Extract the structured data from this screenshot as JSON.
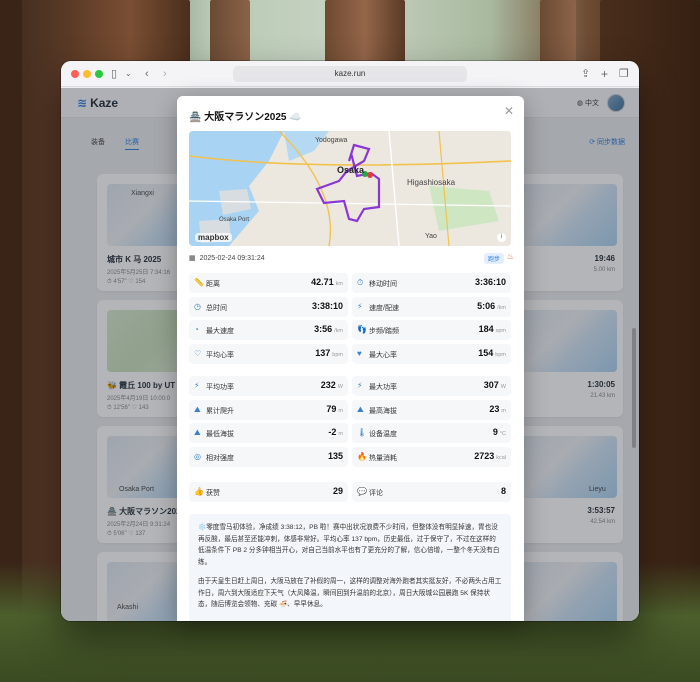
{
  "browser": {
    "url": "kaze.run"
  },
  "app": {
    "brand": "Kaze",
    "lang": "中文",
    "sync_label": "同步数据"
  },
  "nav": {
    "tab_gear": "装备",
    "tab_race": "比赛"
  },
  "cards": [
    {
      "title": "城市 K 马 2025",
      "sub": "2025年5月25日 7:34:16",
      "meta": "⏱ 4'57\"  ♡ 154"
    },
    {
      "title": "🐝 霞丘 100 by UT",
      "sub": "2025年4月19日 10:00:0",
      "meta": "⏱ 12'56\"  ♡ 143"
    },
    {
      "title": "🏯 大阪マラソン2025",
      "sub": "2025年2月24日 9:31:24",
      "meta": "⏱ 5'06\"  ♡ 137"
    },
    {
      "right_value": "19:46",
      "right_unit": "5.00 km"
    },
    {
      "right_value": "1:30:05",
      "right_unit": "21.43 km"
    },
    {
      "right_value": "3:53:57",
      "right_unit": "42.54 km"
    }
  ],
  "map_labels": {
    "card_left_1": "Xiangxi",
    "card_left_3": "Osaka Port",
    "card_left_4": "Akashi",
    "card_right_3": "Lieyu"
  },
  "modal": {
    "title": "🏯 大阪マラソン2025 ☁️",
    "date": "2025-02-24 09:31:24",
    "tag": "跑步",
    "map": {
      "yodogawa": "Yodogawa",
      "osaka": "Osaka",
      "higashiosaka": "Higashiosaka",
      "yao": "Yao",
      "osaka_port": "Osaka Port",
      "mapbox": "mapbox"
    },
    "stats_a": [
      {
        "icon": "📏",
        "label": "距离",
        "value": "42.71",
        "unit": "km"
      },
      {
        "icon": "⏱",
        "label": "移动时间",
        "value": "3:36:10",
        "unit": ""
      },
      {
        "icon": "◷",
        "label": "总时间",
        "value": "3:38:10",
        "unit": ""
      },
      {
        "icon": "⚡",
        "label": "速度/配速",
        "value": "5:06",
        "unit": "/km"
      },
      {
        "icon": "◔",
        "label": "最大速度",
        "value": "3:56",
        "unit": "/km"
      },
      {
        "icon": "👣",
        "label": "步频/踏频",
        "value": "184",
        "unit": "spm"
      },
      {
        "icon": "♡",
        "label": "平均心率",
        "value": "137",
        "unit": "bpm"
      },
      {
        "icon": "♥",
        "label": "最大心率",
        "value": "154",
        "unit": "bpm"
      }
    ],
    "stats_b": [
      {
        "icon": "⚡",
        "label": "平均功率",
        "value": "232",
        "unit": "W"
      },
      {
        "icon": "⚡",
        "label": "最大功率",
        "value": "307",
        "unit": "W"
      },
      {
        "icon": "⛰",
        "label": "累计爬升",
        "value": "79",
        "unit": "m"
      },
      {
        "icon": "⛰",
        "label": "最高海拔",
        "value": "23",
        "unit": "m"
      },
      {
        "icon": "⛰",
        "label": "最低海拔",
        "value": "-2",
        "unit": "m"
      },
      {
        "icon": "🌡",
        "label": "设备温度",
        "value": "9",
        "unit": "°C"
      },
      {
        "icon": "◎",
        "label": "相对强度",
        "value": "135",
        "unit": ""
      },
      {
        "icon": "🔥",
        "label": "热量消耗",
        "value": "2723",
        "unit": "kcal"
      }
    ],
    "stats_c": [
      {
        "icon": "👍",
        "label": "获赞",
        "value": "29",
        "unit": ""
      },
      {
        "icon": "💬",
        "label": "评论",
        "value": "8",
        "unit": ""
      }
    ],
    "note_p1": "❄️零度雪马初体验，净成绩 3:38:12，PB 啦！赛中出状况浪费不少时间，但整体没有明显掉速，胃也没再反酸，最后甚至还能冲刺，体感非常好。平均心率 137 bpm，历史最低，过于保守了，不过在这样的低温条件下 PB 2 分多钟相当开心，对自己当前水平也有了更充分的了解，信心倍增，一整个冬天没有白练。",
    "note_p2": "由于天皇生日赶上周日，大阪马放在了补假的周一，这样的调整对海外跑者其实挺友好，不必两头占用工作日，周六到大阪适应下天气（大风降温，瞬间回到升温前的北京），周日大阪城公园晨跑 5K 保持状态，随后博览会领物、充碳 🍜、早早休息。"
  }
}
